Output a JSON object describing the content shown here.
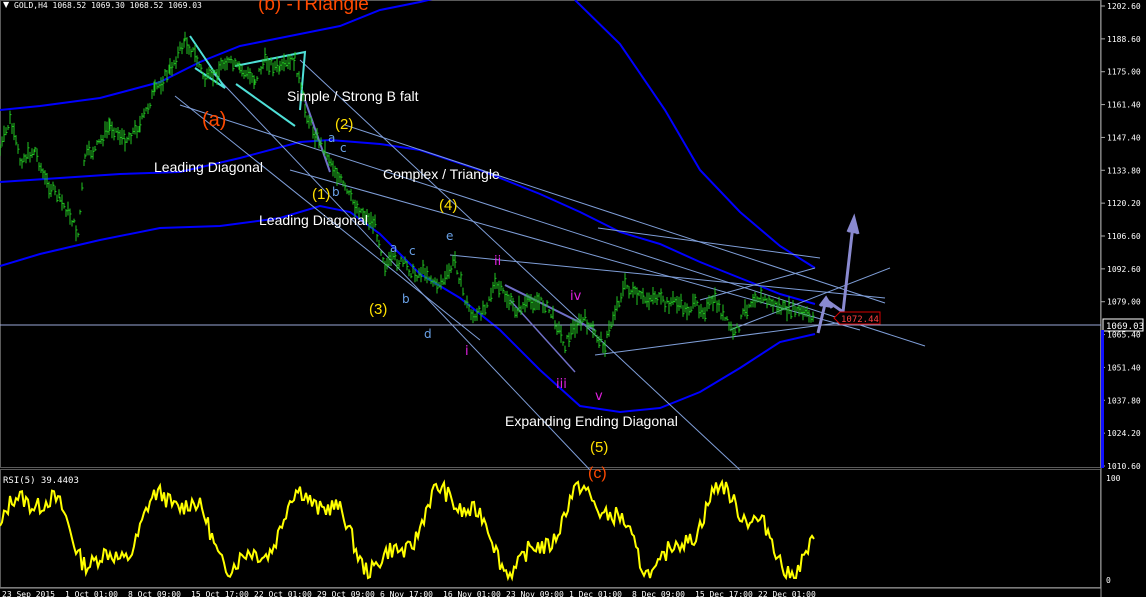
{
  "window": {
    "symbol_header": "GOLD,H4  1068.52 1069.30 1068.52 1069.03",
    "collapse_glyph": "▼"
  },
  "price_axis": {
    "ticks": [
      "1202.60",
      "1188.60",
      "1175.00",
      "1161.40",
      "1147.40",
      "1133.80",
      "1120.20",
      "1106.60",
      "1092.60",
      "1079.00",
      "1065.40",
      "1051.40",
      "1037.80",
      "1024.20",
      "1010.60"
    ],
    "current_price": "1069.03",
    "alert_price": "1072.44"
  },
  "rsi": {
    "header": "RSI(5) 39.4403",
    "axis_top": "100",
    "axis_bottom": "0"
  },
  "time_axis": {
    "labels": [
      "23 Sep 2015",
      "1 Oct 01:00",
      "8 Oct 09:00",
      "15 Oct 17:00",
      "22 Oct 01:00",
      "29 Oct 09:00",
      "6 Nov 17:00",
      "16 Nov 01:00",
      "23 Nov 09:00",
      "1 Dec 01:00",
      "8 Dec 09:00",
      "15 Dec 17:00",
      "22 Dec 01:00"
    ]
  },
  "annotations": {
    "b_triangle": "(b) -TRiangle",
    "a_wave": "(a)",
    "c_wave": "(c)",
    "simple_strong": "Simple / Strong B falt",
    "leading_diag_1": "Leading Diagonal",
    "leading_diag_2": "Leading Diagonal",
    "complex_triangle": "Complex / Triangle",
    "expanding": "Expanding Ending Diagonal",
    "w1": "(1)",
    "w2": "(2)",
    "w3": "(3)",
    "w4": "(4)",
    "w5": "(5)",
    "sub_a1": "a",
    "sub_b1": "b",
    "sub_c1": "c",
    "sub_a2": "a",
    "sub_b2": "b",
    "sub_c2": "c",
    "sub_d2": "d",
    "sub_e2": "e",
    "ri": "i",
    "rii": "ii",
    "riii": "iii",
    "riv": "iv",
    "rv": "v"
  },
  "colors": {
    "background": "#000000",
    "candles": "#22c322",
    "bands": "#0000ff",
    "trendlines": "#7f9ed8",
    "rsi_line": "#ffff00",
    "label_yellow": "#ffe000",
    "label_orange": "#ff4a00",
    "label_magenta": "#e020e0",
    "label_blue": "#6aa2e8",
    "alert_red": "#d40000",
    "cyan_lines": "#4fe0d8",
    "arrows": "#8888cc",
    "blue_bar": "#1010ff"
  }
}
